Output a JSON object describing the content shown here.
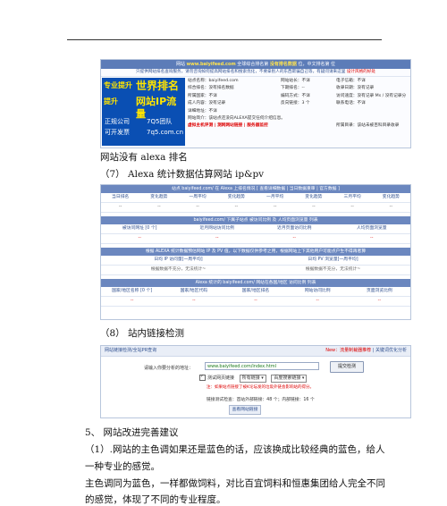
{
  "shot1": {
    "header_pre": "网站 ",
    "header_domain": "www.baiyifeed.com",
    "header_mid": " 全球综合排名第 ",
    "header_rank": "没有排名数据",
    "header_post": " 位，中文排名第 位",
    "subheader": "只提供网站排名查询服务，请勿咨询如何提高网站排名和搜索优化，不要拿别人的东西欺骗自己等，有疑问请来这里 ",
    "subheader_link": "设计风格的好处",
    "ad": {
      "line1": "专业提升",
      "line2": "世界排名",
      "line3": "提升",
      "line4": "网站IP流量",
      "line5": "正规公司",
      "line6": "7Q5团队",
      "line7": "可开发票",
      "line8": "7q5.com.cn"
    },
    "rows": [
      {
        "c1": "站点名称：baiyifeed.com",
        "c2": "网站站长：不详",
        "c3": "电子信箱：不详"
      },
      {
        "c1": "综合排名：没有排名数据",
        "c2": "下期排名：--",
        "c3": "收录日期：没有记录"
      },
      {
        "c1": "所属国家：不详",
        "c2": "编码方式：不详",
        "c3": "访问速度：没有记录 Ms / 没有记录分"
      },
      {
        "c1": "成人内容：没有记录",
        "c2": "反向链接：3 个",
        "c3": "联系电话：不详"
      },
      {
        "c1": "详细地址：不详",
        "c2": "",
        "c3": ""
      },
      {
        "c1": "网站简介：该站点还没向ALEXA提交任何介绍信息。",
        "c2": "",
        "c3": ""
      },
      {
        "c1": "虚拟主机评测 | 测网网站链接 | 服务器监控",
        "c2": "",
        "c3": "所属目录：该站未被百科目录收录"
      }
    ]
  },
  "caption1": "网站没有 alexa 排名",
  "caption2": "（7）  Alexa 统计数据估算网站 ip&pv",
  "shot2": {
    "bar1": "站点 baiyifeed.com/ 在 Alexa 上排名情况 [ 查看详细数据 | 当日数据重审 | 官方数据 ]",
    "headers1": [
      "当日排名",
      "变化趋势",
      "一周平均",
      "变化趋势",
      "一月平均",
      "变化趋势",
      "三月平均",
      "变化趋势"
    ],
    "values1": [
      "--",
      "--",
      "--",
      "--",
      "--",
      "--",
      "--",
      "--"
    ],
    "bar2": "baiyifeed.com/ 下属子站点 被访问比例 及 人均页面浏览量 列表",
    "headers2": [
      "被访问网址 [0 个]",
      "近月网站访问比例",
      "近月页面访问比例",
      "人均页面浏览量"
    ],
    "values2": [
      "--",
      "--",
      "--",
      "--"
    ],
    "bar3": "根据 ALEXA 统计数据预估网站 IP 及 PV 值，以下数据仅供参考之用，根据网站上下其他用户可能点户生不得再者算",
    "headers3": [
      "日均 IP 访问量[一周平均]",
      "日均 PV 浏览量[一周平均]"
    ],
    "values3": [
      "根据数据不充分，无法统计~",
      "根据数据不充分，无法统计~"
    ],
    "bar4": "Alexa 统计的 baiyifeed.com/ 网站在各国/地区 访问比例 列表",
    "headers4": [
      "国家/地区名称 [0 个]",
      "国家/地区代码",
      "国家/地区排名",
      "网站访问比例",
      "页面浏览比例"
    ],
    "values4": [
      "--",
      "--",
      "--",
      "--",
      "--"
    ]
  },
  "caption3": "（8）  站内链接检测",
  "shot3": {
    "top_left": "网站链接检测/全站PR查询",
    "top_right_red": "New：流量制裁器推荐",
    "top_right_blue": " | 关键词优化分析",
    "label": "请输入你要分析的地址：",
    "input_value": "www.baiyifeed.com/index.html",
    "button": "提交检测",
    "checkbox_label": "测试网页链接",
    "select1": "所有链接  ▾",
    "select2": "百度搜索链接    ▾",
    "warning": "注：如果站点链接了被K论坛发的垃圾外链会影响站的得分。",
    "result": "链接测试检查：首站外部链接：48 个；内部链接：16 个",
    "button2": "查看网站链接"
  },
  "para1": "5、        网站改进完善建议",
  "para2": "（1）.网站的主色调如果还是蓝色的话，应该换成比较经典的蓝色，给人",
  "para3": "一种专业的感觉。",
  "para4": "主色调同为蓝色，一样都做饲料，对比百宜饲料和恒惠集团给人完全不同",
  "para5": "的感觉，体现了不同的专业程度。"
}
